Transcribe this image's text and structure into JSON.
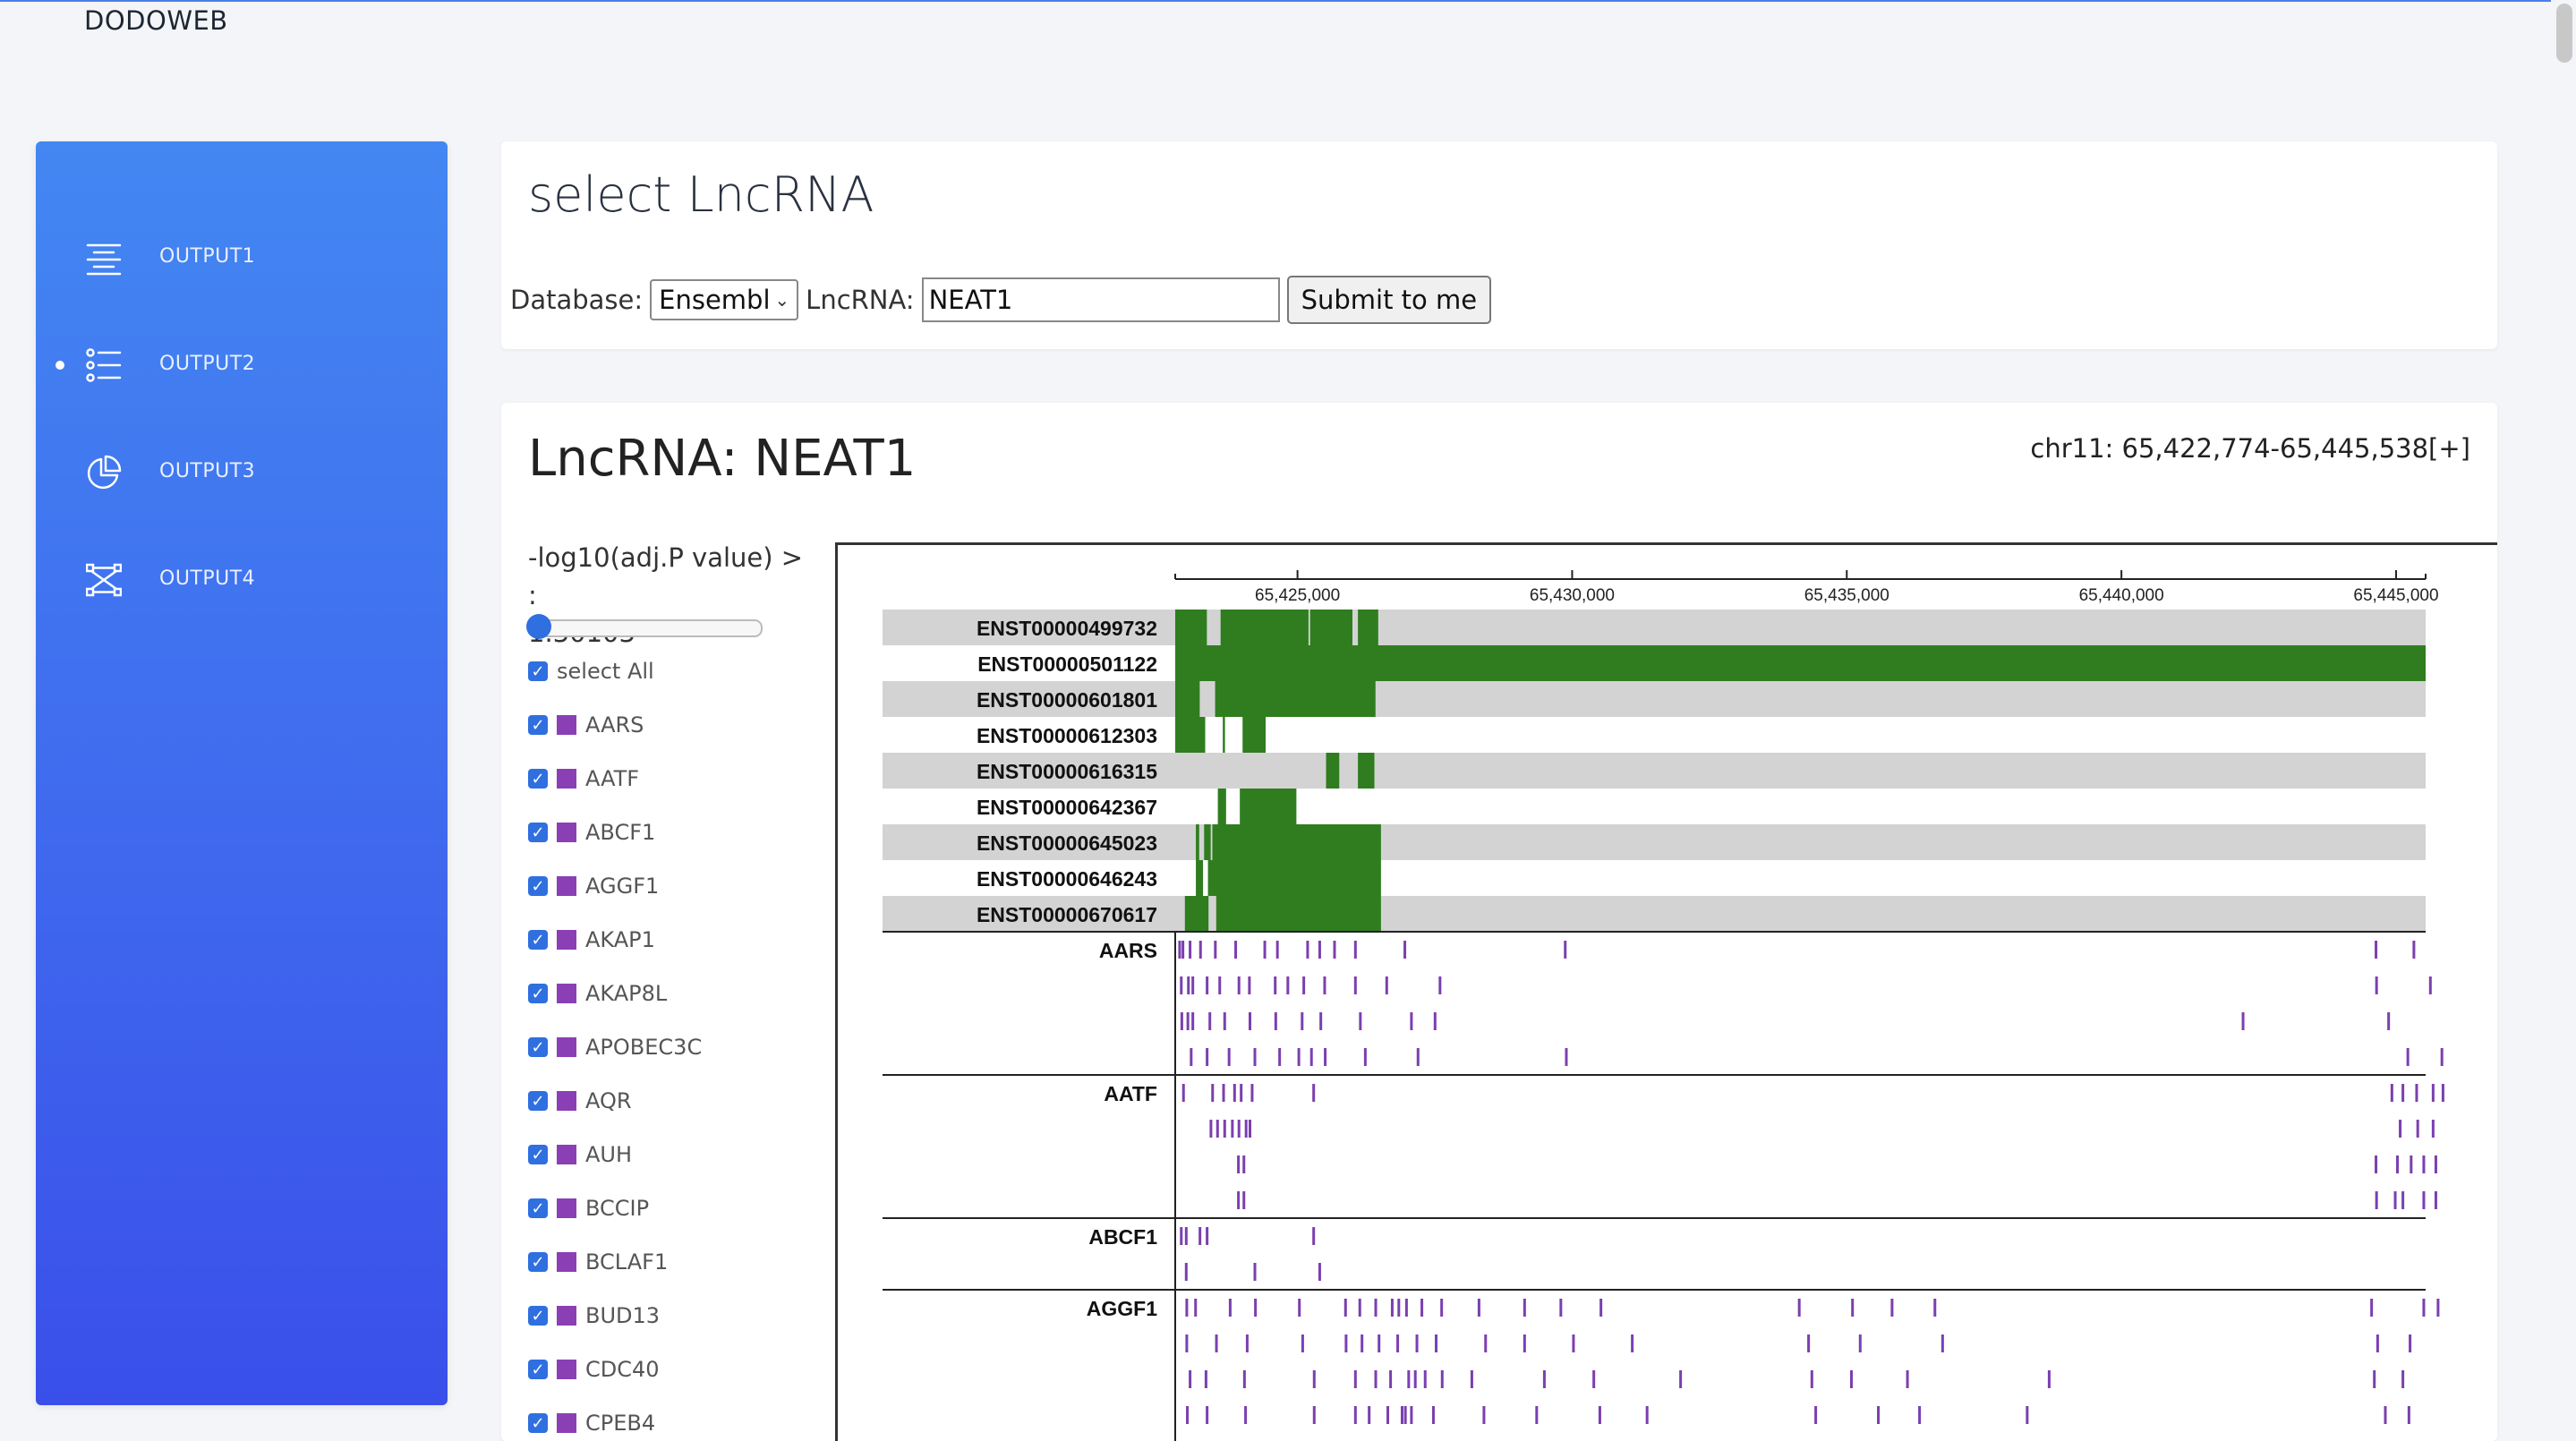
{
  "app": {
    "brand": "DODOWEB"
  },
  "sidebar": {
    "items": [
      {
        "label": "OUTPUT1",
        "icon": "align-center-icon",
        "active": false
      },
      {
        "label": "OUTPUT2",
        "icon": "list-icon",
        "active": true
      },
      {
        "label": "OUTPUT3",
        "icon": "pie-chart-icon",
        "active": false
      },
      {
        "label": "OUTPUT4",
        "icon": "network-icon",
        "active": false
      }
    ]
  },
  "select_card": {
    "title": "select LncRNA",
    "database_label": "Database:",
    "database_value": "Ensembl",
    "lncrna_label": "LncRNA:",
    "lncrna_value": "NEAT1",
    "submit_label": "Submit to me"
  },
  "result": {
    "title": "LncRNA: NEAT1",
    "coords": "chr11: 65,422,774-65,445,538[+]",
    "filter_label": "-log10(adj.P value) > :",
    "filter_value": "1.30103",
    "slider_fraction": 0,
    "select_all_label": "select All",
    "genes": [
      "AARS",
      "AATF",
      "ABCF1",
      "AGGF1",
      "AKAP1",
      "AKAP8L",
      "APOBEC3C",
      "AQR",
      "AUH",
      "BCCIP",
      "BCLAF1",
      "BUD13",
      "CDC40",
      "CPEB4"
    ]
  },
  "chart_data": {
    "type": "gene-track",
    "x_axis": {
      "ticks": [
        65425000,
        65430000,
        65435000,
        65440000,
        65445000
      ],
      "tick_labels": [
        "65,425,000",
        "65,430,000",
        "65,435,000",
        "65,440,000",
        "65,445,000"
      ],
      "range": [
        65422774,
        65445538
      ]
    },
    "colors": {
      "exon": "#2f7d1f",
      "row_bg": "#d3d3d3",
      "peak": "#7b3fb0"
    },
    "transcripts": [
      {
        "id": "ENST00000499732",
        "exons": [
          [
            65422774,
            65423350
          ],
          [
            65423600,
            65425200
          ],
          [
            65425230,
            65426000
          ],
          [
            65426100,
            65426470
          ]
        ]
      },
      {
        "id": "ENST00000501122",
        "exons": [
          [
            65422774,
            65445538
          ]
        ]
      },
      {
        "id": "ENST00000601801",
        "exons": [
          [
            65422774,
            65423220
          ],
          [
            65423500,
            65426420
          ]
        ]
      },
      {
        "id": "ENST00000612303",
        "exons": [
          [
            65422774,
            65423320
          ],
          [
            65423640,
            65423680
          ],
          [
            65424000,
            65424420
          ]
        ]
      },
      {
        "id": "ENST00000616315",
        "exons": [
          [
            65425520,
            65425760
          ],
          [
            65426100,
            65426400
          ]
        ]
      },
      {
        "id": "ENST00000642367",
        "exons": [
          [
            65423550,
            65423700
          ],
          [
            65423950,
            65424980
          ]
        ]
      },
      {
        "id": "ENST00000645023",
        "exons": [
          [
            65423150,
            65423210
          ],
          [
            65423300,
            65423420
          ],
          [
            65423450,
            65426520
          ]
        ]
      },
      {
        "id": "ENST00000646243",
        "exons": [
          [
            65423150,
            65423280
          ],
          [
            65423370,
            65426520
          ]
        ]
      },
      {
        "id": "ENST00000670617",
        "exons": [
          [
            65422950,
            65423380
          ],
          [
            65423520,
            65426520
          ]
        ]
      }
    ],
    "rbp_peaks": [
      {
        "name": "AARS",
        "rows": [
          [
            65422830,
            65422890,
            65423020,
            65423210,
            65423480,
            65423850,
            65424380,
            65424610,
            65425160,
            65425380,
            65425650,
            65426030,
            65426930,
            65429850,
            65444610,
            65445300
          ],
          [
            65422860,
            65422990,
            65423070,
            65423330,
            65423560,
            65423910,
            65424100,
            65424570,
            65424800,
            65425090,
            65425470,
            65426030,
            65426600,
            65427570,
            65444620,
            65445600
          ],
          [
            65422870,
            65422980,
            65423070,
            65423380,
            65423650,
            65424110,
            65424580,
            65425060,
            65425400,
            65426120,
            65427050,
            65427480,
            65442190,
            65444840
          ],
          [
            65423040,
            65423330,
            65423730,
            65424200,
            65424650,
            65425000,
            65425230,
            65425480,
            65426210,
            65427170,
            65429870,
            65445190,
            65445810
          ]
        ]
      },
      {
        "name": "AATF",
        "rows": [
          [
            65422900,
            65423430,
            65423630,
            65423830,
            65423950,
            65424150,
            65425270,
            65444900,
            65445100,
            65445350,
            65445650,
            65445830
          ],
          [
            65423400,
            65423520,
            65423650,
            65423790,
            65423910,
            65424040,
            65424110,
            65445050,
            65445370,
            65445650
          ],
          [
            65423900,
            65424000,
            65444610,
            65445000,
            65445250,
            65445480,
            65445700
          ],
          [
            65423900,
            65424000,
            65444620,
            65444960,
            65445100,
            65445480,
            65445700
          ]
        ]
      },
      {
        "name": "ABCF1",
        "rows": [
          [
            65422860,
            65422950,
            65423200,
            65423330,
            65425270
          ],
          [
            65422950,
            65424200,
            65425380
          ]
        ]
      },
      {
        "name": "AGGF1",
        "rows": [
          [
            65422960,
            65423120,
            65423750,
            65424210,
            65425010,
            65425850,
            65426110,
            65426400,
            65426700,
            65426820,
            65426960,
            65427240,
            65427600,
            65428280,
            65429110,
            65429770,
            65430500,
            65434110,
            65435080,
            65435800,
            65436580,
            65444530,
            65445480,
            65445740
          ],
          [
            65422960,
            65423500,
            65424060,
            65425070,
            65425860,
            65426150,
            65426460,
            65426800,
            65427150,
            65427500,
            65428400,
            65429110,
            65430000,
            65431070,
            65434280,
            65435220,
            65436720,
            65444640,
            65445230
          ],
          [
            65423020,
            65423310,
            65424010,
            65425280,
            65426030,
            65426400,
            65426670,
            65427000,
            65427120,
            65427300,
            65427610,
            65428150,
            65429470,
            65430370,
            65431950,
            65434340,
            65435060,
            65436080,
            65438660,
            65444580,
            65445100
          ],
          [
            65422970,
            65423330,
            65424030,
            65425280,
            65426030,
            65426280,
            65426620,
            65426880,
            65426940,
            65427050,
            65427450,
            65428370,
            65429330,
            65430480,
            65431340,
            65434410,
            65435550,
            65436300,
            65438260,
            65444780,
            65445210
          ]
        ]
      }
    ]
  }
}
